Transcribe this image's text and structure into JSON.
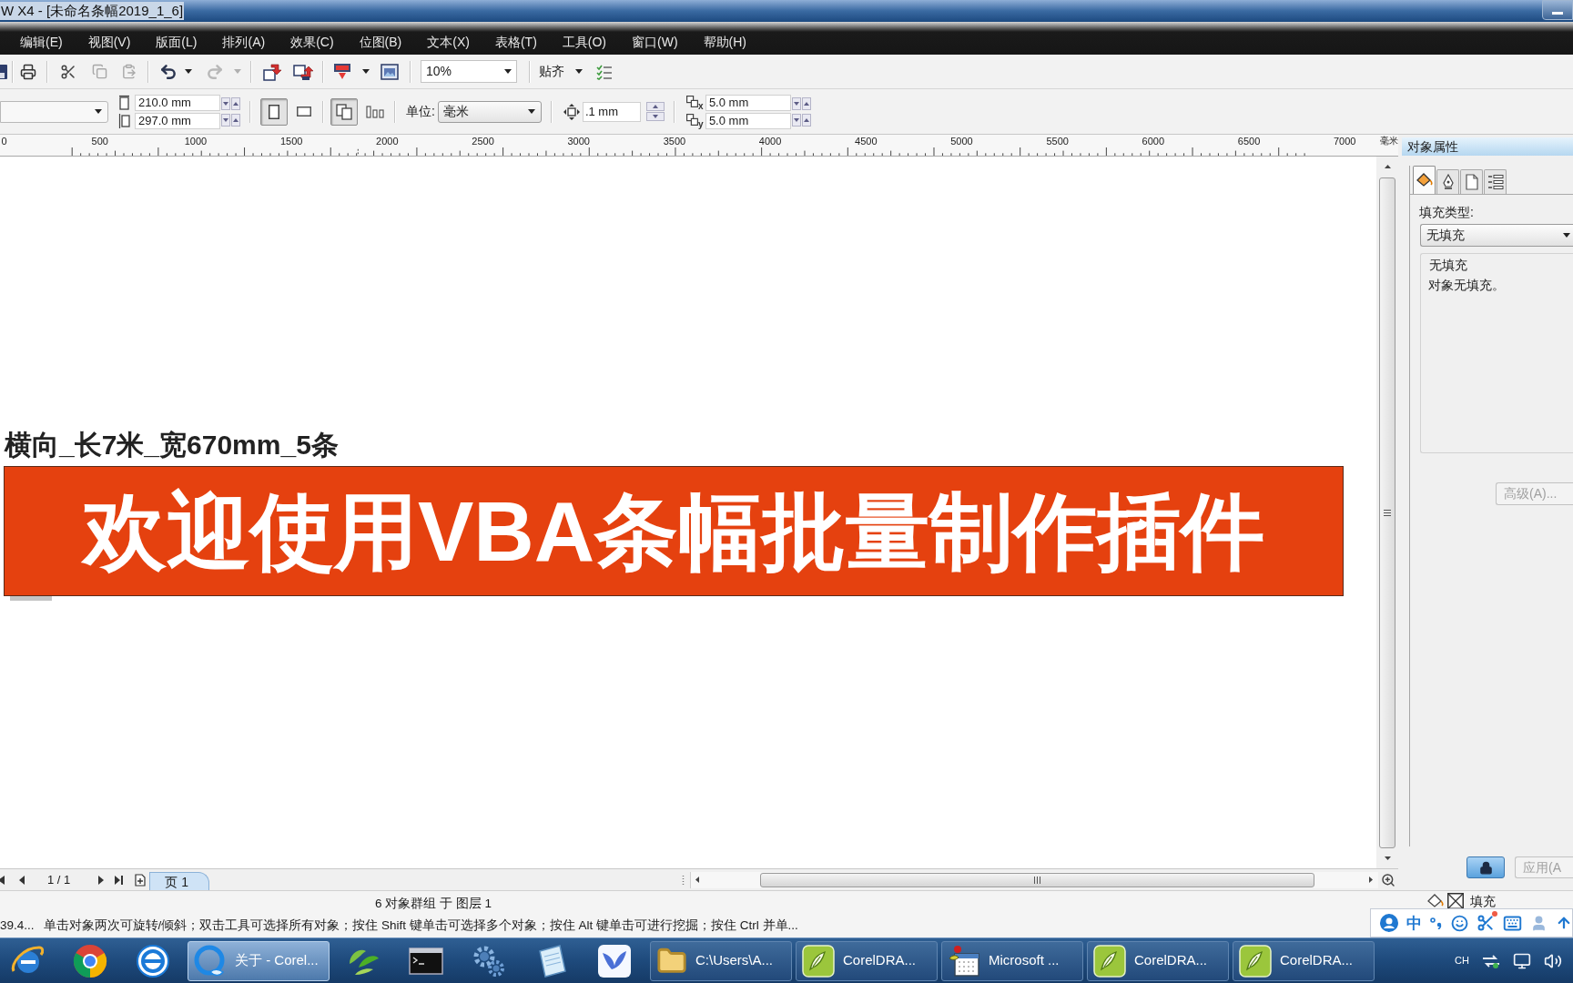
{
  "window": {
    "title": "W X4 - [未命名条幅2019_1_6]"
  },
  "menu_bar": [
    "编辑(E)",
    "视图(V)",
    "版面(L)",
    "排列(A)",
    "效果(C)",
    "位图(B)",
    "文本(X)",
    "表格(T)",
    "工具(O)",
    "窗口(W)",
    "帮助(H)"
  ],
  "toolbar": {
    "zoom": "10%",
    "snap": "贴齐"
  },
  "property_bar": {
    "page_width": "210.0 mm",
    "page_height": "297.0 mm",
    "orientation": [
      {
        "kind": "portrait",
        "selected": true
      },
      {
        "kind": "landscape",
        "selected": false
      }
    ],
    "page_scope": [
      {
        "kind": "all_pages",
        "selected": true
      },
      {
        "kind": "current_page",
        "selected": false
      }
    ],
    "unit_label": "单位:",
    "unit": "毫米",
    "nudge": ".1 mm",
    "duplicate": [
      {
        "axis": "x",
        "value": "5.0 mm"
      },
      {
        "axis": "y",
        "value": "5.0 mm"
      }
    ]
  },
  "ruler": {
    "labels": [
      "0",
      "500",
      "1000",
      "1500",
      "2000",
      "2500",
      "3000",
      "3500",
      "4000",
      "4500",
      "5000",
      "5500",
      "6000",
      "6500",
      "7000"
    ],
    "unit": "毫米"
  },
  "canvas": {
    "caption": "横向_长7米_宽670mm_5条",
    "banner": "欢迎使用VBA条幅批量制作插件"
  },
  "page_navigator": {
    "position": "1 / 1",
    "pages": [
      {
        "label": "页 1",
        "selected": true
      }
    ]
  },
  "docker": {
    "title": "对象属性",
    "tabs": [
      {
        "kind": "fill",
        "selected": true
      },
      {
        "kind": "outline",
        "selected": false
      },
      {
        "kind": "general",
        "selected": false
      },
      {
        "kind": "summary",
        "selected": false
      }
    ],
    "fill_type_label": "填充类型:",
    "fill_type": "无填充",
    "info_title": "无填充",
    "info_text": "对象无填充。",
    "advanced_button": {
      "label": "高级(A)...",
      "disabled": true
    },
    "lock_button": {
      "on": true
    },
    "apply_button": {
      "label": "应用(A",
      "disabled": true
    }
  },
  "status_bar": {
    "selection": "6 对象群组 于 图层 1",
    "fill": "填充",
    "cursor": "39.4...",
    "hint": "单击对象两次可旋转/倾斜；双击工具可选择所有对象；按住 Shift 键单击可选择多个对象；按住 Alt 键单击可进行挖掘；按住 Ctrl 并单..."
  },
  "ime_bar": {
    "mode": "中"
  },
  "taskbar": {
    "tasks": [
      {
        "label": "关于 - Corel...",
        "selected": true
      },
      {
        "label": "C:\\Users\\A...",
        "selected": false
      },
      {
        "label": "CorelDRA...",
        "selected": false
      },
      {
        "label": "Microsoft ...",
        "selected": false
      },
      {
        "label": "CorelDRA...",
        "selected": false
      },
      {
        "label": "CorelDRA...",
        "selected": false
      }
    ],
    "tray_language": "CH"
  }
}
